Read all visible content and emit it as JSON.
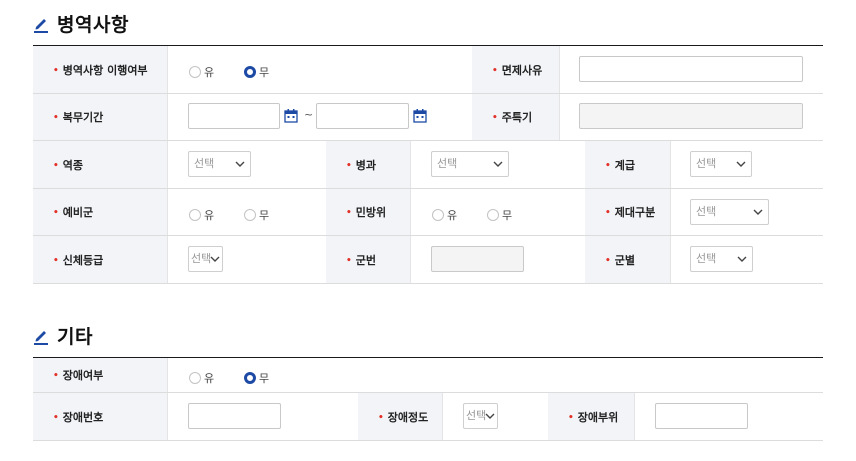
{
  "military": {
    "title": "병역사항",
    "labels": {
      "service_status": "병역사항 이행여부",
      "exemption_reason": "면제사유",
      "service_period": "복무기간",
      "main_specialty": "주특기",
      "service_type": "역종",
      "branch": "병과",
      "rank": "계급",
      "reserve": "예비군",
      "civil_defense": "민방위",
      "discharge_type": "제대구분",
      "physical_grade": "신체등급",
      "service_number": "군번",
      "army": "군별"
    },
    "service_status_options": [
      "유",
      "무"
    ],
    "service_status_selected": "무",
    "reserve_options": [
      "유",
      "무"
    ],
    "civil_defense_options": [
      "유",
      "무"
    ],
    "period_separator": "~",
    "select_placeholder": "선택"
  },
  "other": {
    "title": "기타",
    "labels": {
      "disability": "장애여부",
      "disability_number": "장애번호",
      "disability_degree": "장애정도",
      "disability_part": "장애부위"
    },
    "disability_options": [
      "유",
      "무"
    ],
    "disability_selected": "무",
    "select_placeholder": "선택"
  },
  "colors": {
    "accent": "#1d4aa5",
    "label_bg": "#f2f4f8",
    "bullet": "#e2332b"
  },
  "icons": {
    "section": "pencil-icon",
    "date": "calendar-icon",
    "select": "chevron-down-icon"
  }
}
